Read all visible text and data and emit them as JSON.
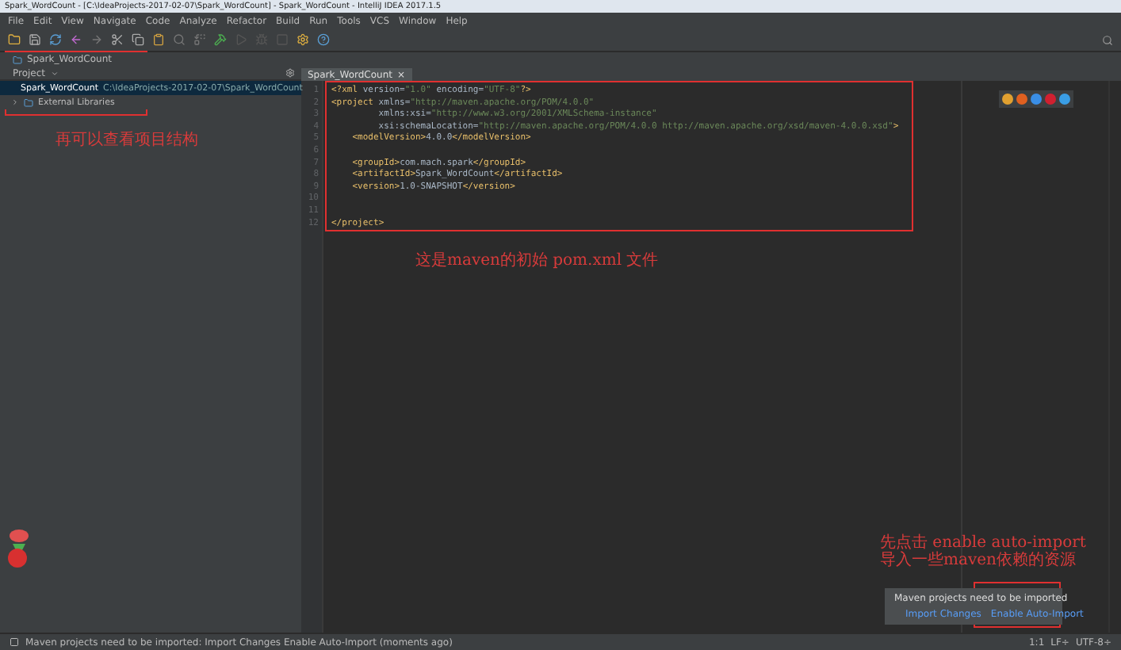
{
  "window": {
    "title": "Spark_WordCount - [C:\\IdeaProjects-2017-02-07\\Spark_WordCount] - Spark_WordCount - IntelliJ IDEA 2017.1.5"
  },
  "menu": [
    "File",
    "Edit",
    "View",
    "Navigate",
    "Code",
    "Analyze",
    "Refactor",
    "Build",
    "Run",
    "Tools",
    "VCS",
    "Window",
    "Help"
  ],
  "navbar": {
    "crumb": "Spark_WordCount"
  },
  "project_panel": {
    "title": "Project",
    "tree": [
      {
        "label": "Spark_WordCount",
        "path": "C:\\IdeaProjects-2017-02-07\\Spark_WordCount",
        "selected": true,
        "expanded": false
      },
      {
        "label": "External Libraries",
        "selected": false,
        "expanded": false
      }
    ]
  },
  "editor": {
    "tabs": [
      {
        "label": "Spark_WordCount",
        "selected": true,
        "close": "×"
      }
    ],
    "lines": [
      {
        "number": "1",
        "code": "<?xml version=\"1.0\" encoding=\"UTF-8\"?>"
      },
      {
        "number": "2",
        "code": "<project xmlns=\"http://maven.apache.org/POM/4.0.0\""
      },
      {
        "number": "3",
        "code": "         xmlns:xsi=\"http://www.w3.org/2001/XMLSchema-instance\""
      },
      {
        "number": "4",
        "code": "         xsi:schemaLocation=\"http://maven.apache.org/POM/4.0.0 http://maven.apache.org/xsd/maven-4.0.0.xsd\">"
      },
      {
        "number": "5",
        "code": "    <modelVersion>4.0.0</modelVersion>"
      },
      {
        "number": "6"
      },
      {
        "number": "7",
        "code": "    <groupId>com.mach.spark</groupId>"
      },
      {
        "number": "8",
        "code": "    <artifactId>Spark_WordCount</artifactId>"
      },
      {
        "number": "9",
        "code": "    <version>1.0-SNAPSHOT</version>"
      },
      {
        "number": "10"
      },
      {
        "number": "11"
      },
      {
        "number": "12",
        "code": "</project>"
      }
    ]
  },
  "annotations": [
    {
      "kind": "note",
      "lines": [
        "再可以查看项目结构"
      ]
    },
    {
      "kind": "note",
      "lines": [
        "这是maven的初始 pom.xml 文件"
      ]
    },
    {
      "kind": "note",
      "lines": [
        "先点击    enable auto-import",
        "导入一些maven依赖的资源"
      ]
    }
  ],
  "notification": {
    "message": "Maven projects need to be imported",
    "links": [
      "Import Changes",
      "Enable Auto-Import"
    ]
  },
  "status_bar": {
    "message": "Maven projects need to be imported: Import Changes    Enable Auto-Import (moments ago)",
    "position": "1:1",
    "line_separator": "LF÷",
    "encoding": "UTF-8÷"
  }
}
